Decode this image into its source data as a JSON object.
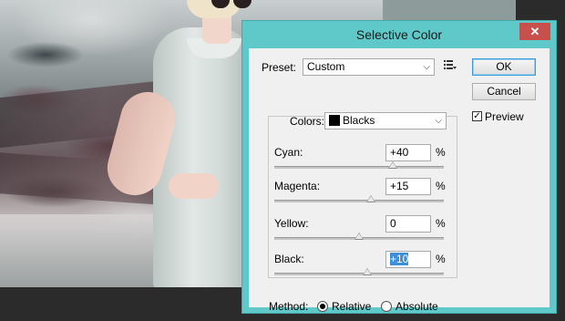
{
  "dialog": {
    "title": "Selective Color",
    "close_glyph": "✕",
    "preset_label": "Preset:",
    "preset_value": "Custom",
    "preset_menu_icon": "preset-options-icon",
    "ok_label": "OK",
    "cancel_label": "Cancel",
    "preview_label": "Preview",
    "preview_checked": true,
    "colors_label": "Colors:",
    "colors_value": "Blacks",
    "colors_swatch": "#000000",
    "sliders": [
      {
        "label": "Cyan:",
        "value": "+40",
        "unit": "%",
        "level": 0.7
      },
      {
        "label": "Magenta:",
        "value": "+15",
        "unit": "%",
        "level": 0.57
      },
      {
        "label": "Yellow:",
        "value": "0",
        "unit": "%",
        "level": 0.5
      },
      {
        "label": "Black:",
        "value": "+10",
        "unit": "%",
        "level": 0.55
      }
    ],
    "method_label": "Method:",
    "method_options": [
      "Relative",
      "Absolute"
    ],
    "method_selected": "Relative"
  },
  "colors": {
    "titlebar": "#5fc8c8",
    "close_button": "#c7504c",
    "text_selection": "#3c8fd8"
  }
}
